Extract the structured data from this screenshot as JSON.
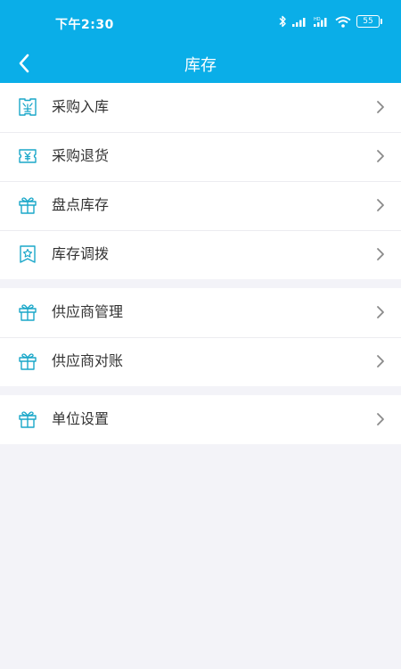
{
  "status": {
    "time": "下午2:30",
    "battery": "55",
    "icons": [
      "bluetooth-icon",
      "signal-icon",
      "signal-hd-icon",
      "wifi-icon",
      "battery-icon"
    ]
  },
  "header": {
    "title": "库存"
  },
  "colors": {
    "accent": "#0aaee8",
    "icon": "#1aa7c9",
    "background": "#f3f3f8",
    "text": "#333333",
    "chevron": "#8a8a8a"
  },
  "groups": [
    {
      "items": [
        {
          "label": "采购入库",
          "icon": "stock-in-icon"
        },
        {
          "label": "采购退货",
          "icon": "yen-return-icon"
        },
        {
          "label": "盘点库存",
          "icon": "gift-box-icon"
        },
        {
          "label": "库存调拨",
          "icon": "star-bookmark-icon"
        }
      ]
    },
    {
      "items": [
        {
          "label": "供应商管理",
          "icon": "gift-box-icon"
        },
        {
          "label": "供应商对账",
          "icon": "gift-box-icon"
        }
      ]
    },
    {
      "items": [
        {
          "label": "单位设置",
          "icon": "gift-box-icon"
        }
      ]
    }
  ]
}
